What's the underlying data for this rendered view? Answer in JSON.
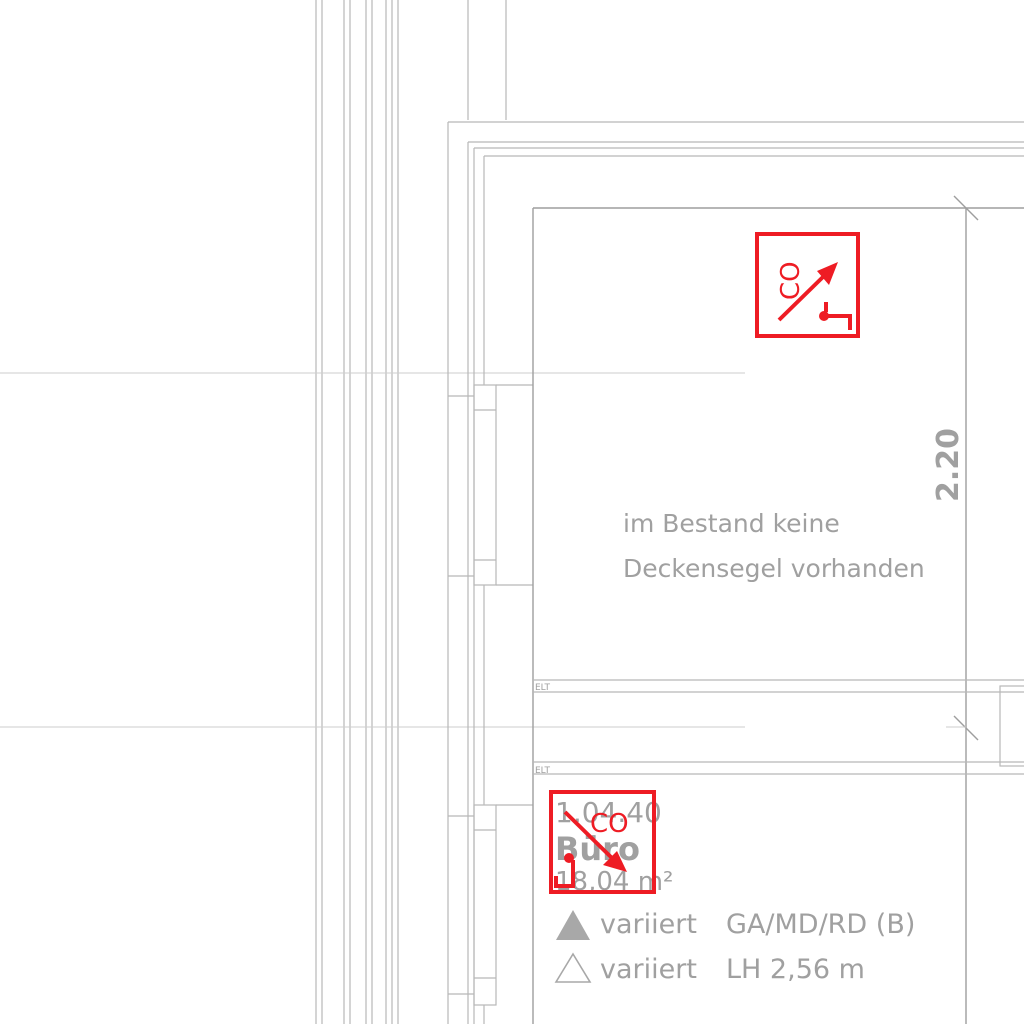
{
  "notes": {
    "line1": "im Bestand keine",
    "line2": "Deckensegel vorhanden"
  },
  "dimension": {
    "value": "2.20"
  },
  "small_labels": {
    "elt_upper": "ELT",
    "elt_lower": "ELT"
  },
  "room": {
    "number": "1.04.40",
    "name": "Büro",
    "area": "18,04 m²",
    "ceiling_row_value": "variiert",
    "ceiling_row_spec": "GA/MD/RD (B)",
    "floor_row_value": "variiert",
    "floor_row_spec": "LH 2,56 m"
  },
  "detectors": {
    "upper": {
      "label": "CO",
      "icon": "co-sensor-icon",
      "color": "#ee1c24"
    },
    "lower": {
      "label": "CO",
      "icon": "co-sensor-icon",
      "color": "#ee1c24"
    }
  },
  "colors": {
    "lines": "#b8b8b8",
    "text": "#a0a0a0",
    "symbols": "#ee1c24"
  }
}
